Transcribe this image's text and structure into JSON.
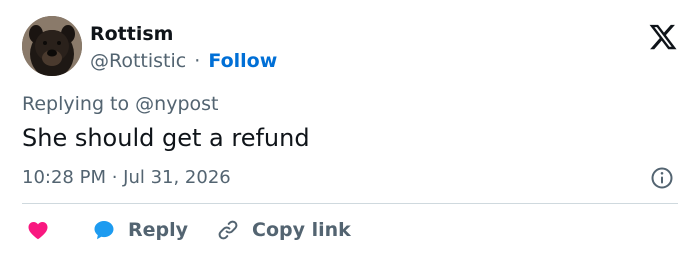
{
  "user": {
    "display_name": "Rottism",
    "handle": "@Rottistic",
    "separator": "·",
    "follow_label": "Follow"
  },
  "reply": {
    "prefix": "Replying to",
    "mention": "@nypost"
  },
  "tweet": {
    "text": "She should get a refund",
    "timestamp": "10:28 PM · Jul 31, 2026"
  },
  "actions": {
    "reply_label": "Reply",
    "copy_link_label": "Copy link"
  },
  "icons": {
    "logo": "x-logo-icon",
    "info": "info-icon",
    "like": "heart-icon",
    "reply": "speech-bubble-icon",
    "copy": "link-icon"
  },
  "colors": {
    "text": "#0f1419",
    "secondary": "#536471",
    "follow": "#006fd6",
    "like": "#f91880",
    "reply": "#1d9bf0",
    "divider": "#cfd9de"
  }
}
